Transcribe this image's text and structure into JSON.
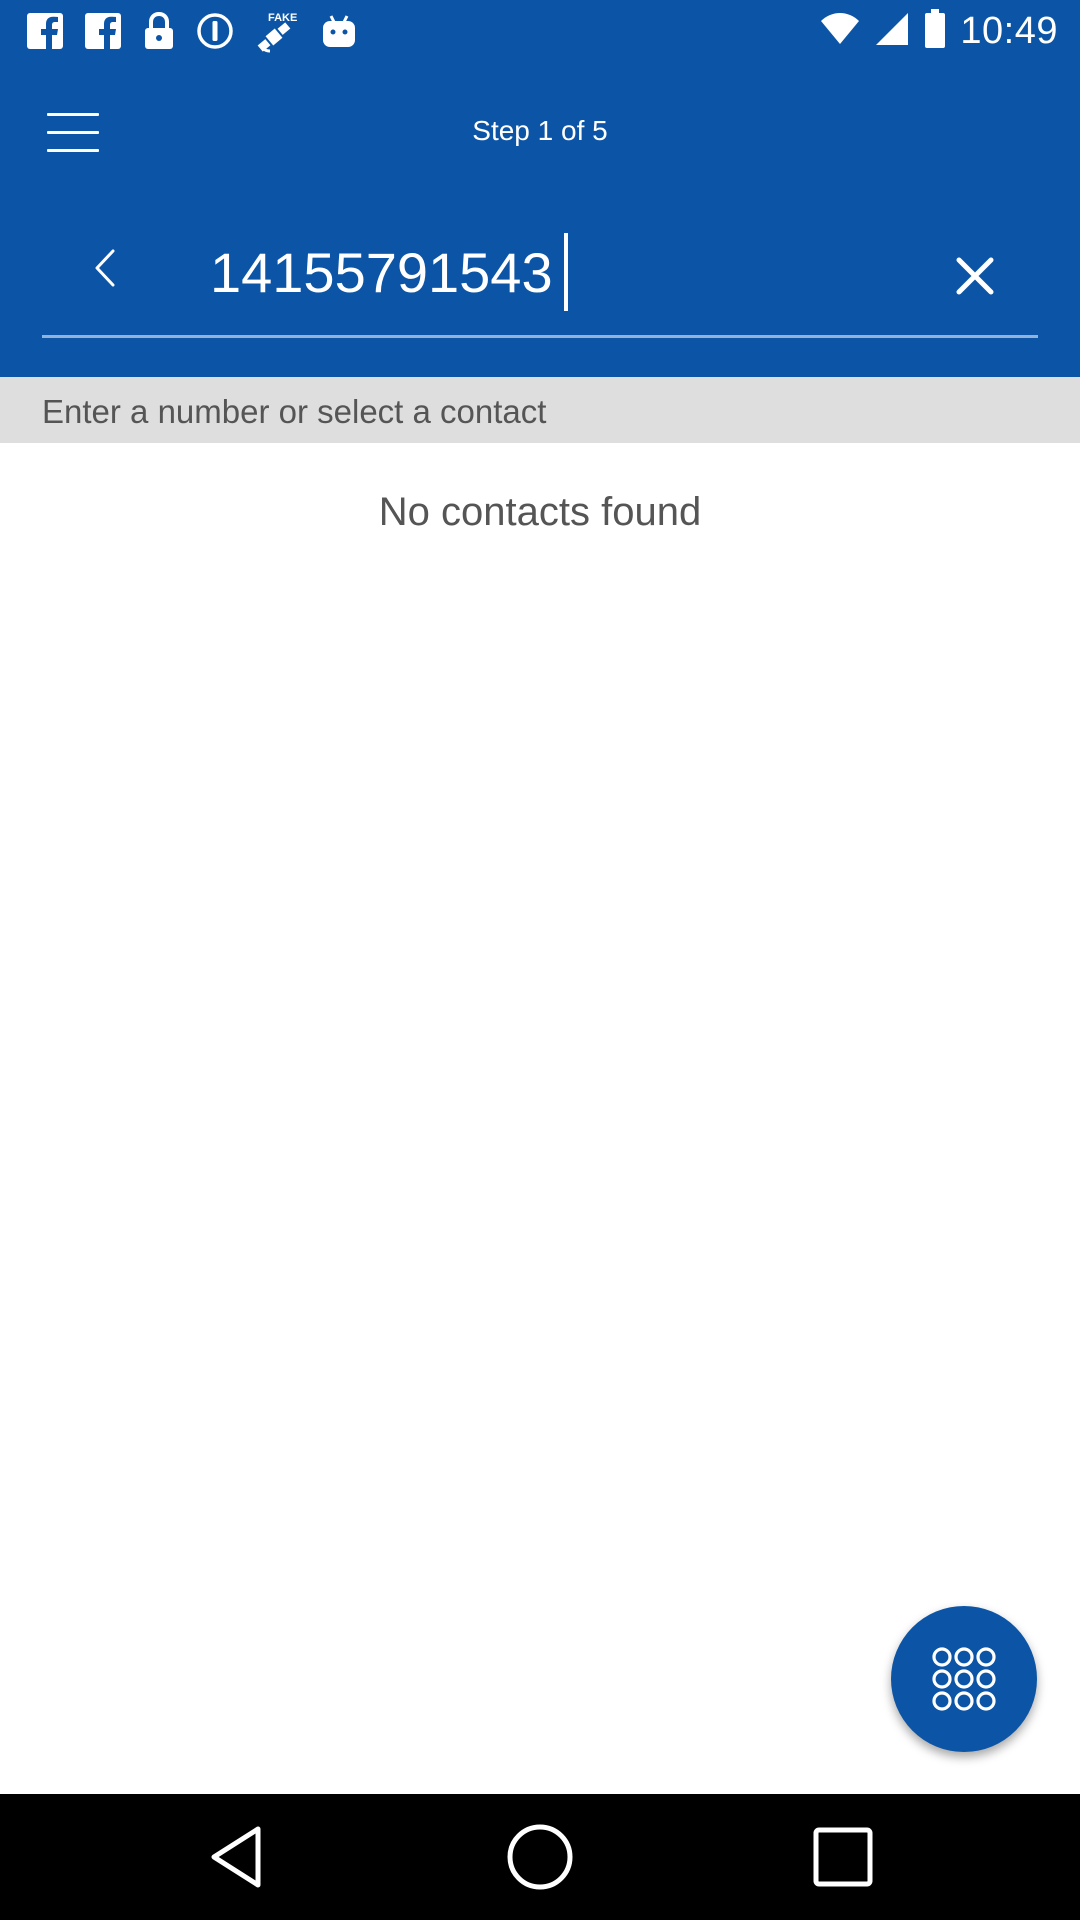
{
  "status_bar": {
    "time": "10:49",
    "left_icons": [
      "facebook-icon",
      "facebook-icon",
      "lock-icon",
      "info-circle-icon",
      "fake-gps-icon",
      "android-icon"
    ],
    "right_icons": [
      "wifi-icon",
      "signal-icon",
      "battery-icon"
    ]
  },
  "header": {
    "menu_icon": "menu-icon",
    "title": "Step 1 of 5"
  },
  "search": {
    "back_icon": "chevron-left-icon",
    "value": "14155791543",
    "clear_icon": "close-icon"
  },
  "hint": {
    "text": "Enter a number or select a contact"
  },
  "results": {
    "empty_text": "No contacts found"
  },
  "fab": {
    "icon": "dialpad-icon"
  },
  "nav_bar": {
    "icons": [
      "back-triangle-icon",
      "home-circle-icon",
      "recents-square-icon"
    ]
  },
  "colors": {
    "primary": "#0c55a6",
    "hint_background": "#dedede",
    "text_secondary": "#555555",
    "nav_background": "#000000"
  }
}
